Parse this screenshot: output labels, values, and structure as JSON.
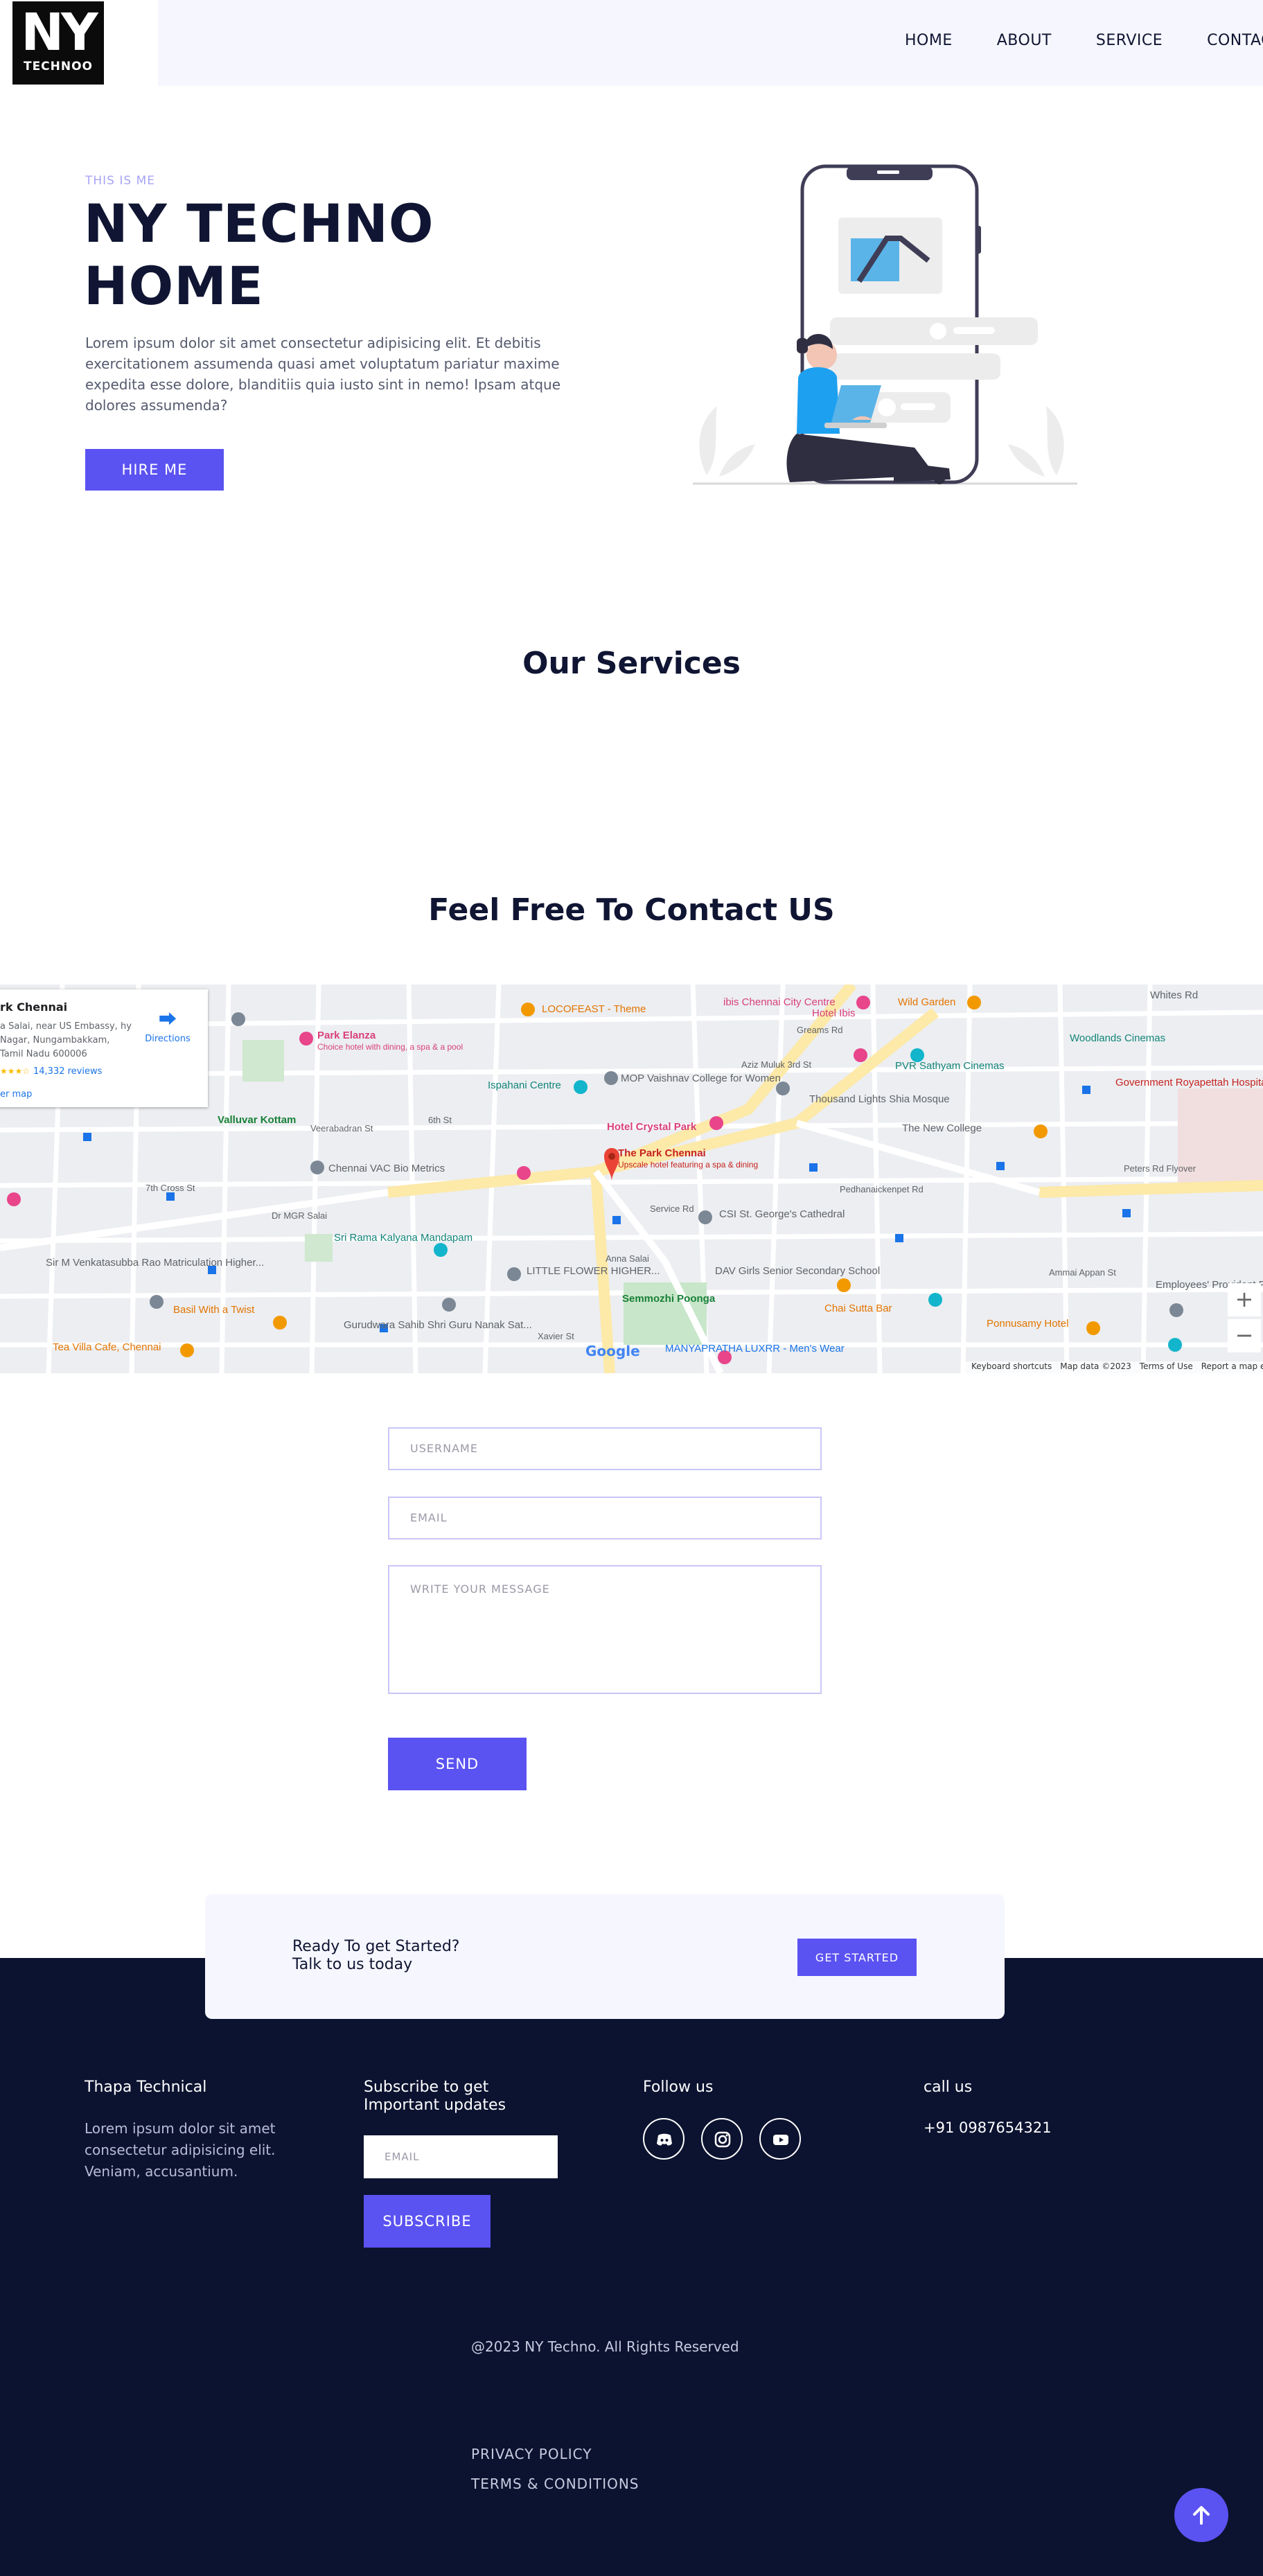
{
  "header": {
    "logo_big": "NY",
    "logo_small": "TECHNOO",
    "nav": [
      "HOME",
      "ABOUT",
      "SERVICE",
      "CONTACT"
    ]
  },
  "hero": {
    "eyebrow": "THIS IS ME",
    "title": "NY TECHNO HOME",
    "description": "Lorem ipsum dolor sit amet consectetur adipisicing elit. Et debitis exercitationem assumenda quasi amet voluptatum pariatur maxime expedita esse dolore, blanditiis quia iusto sint in nemo! Ipsam atque dolores assumenda?",
    "button": "HIRE ME"
  },
  "services": {
    "title": "Our Services"
  },
  "contact": {
    "title": "Feel Free To Contact US"
  },
  "map": {
    "card": {
      "name": "rk Chennai",
      "address": "a Salai, near US Embassy, hy Nagar, Nungambakkam, Tamil Nadu 600006",
      "rating_stars": "★★★☆",
      "reviews": "14,332 reviews",
      "larger_map": "er map",
      "directions": "Directions"
    },
    "labels": [
      "LOCOFEAST - Theme",
      "ibis Chennai City Centre",
      "Hotel Ibis",
      "Wild Garden",
      "Whites Rd",
      "Park Elanza",
      "Choice hotel with dining, a spa & a pool",
      "Woodlands Cinemas",
      "Ispahani Centre",
      "MOP Vaishnav College for Women",
      "PVR Sathyam Cinemas",
      "Government Royapettah Hospital",
      "Valluvar Kottam",
      "Veerabadran St",
      "Hotel Crystal Park",
      "Thousand Lights Shia Mosque",
      "The New College",
      "Chennai VAC Bio Metrics",
      "The Park Chennai",
      "Upscale hotel featuring a spa & dining",
      "Peters Rd Flyover",
      "Dr MGR Salai",
      "Sri Rama Kalyana Mandapam",
      "CSI St. George's Cathedral",
      "Sir M Venkatasubba Rao Matriculation Higher...",
      "LITTLE FLOWER HIGHER...",
      "Semmozhi Poonga",
      "DAV Girls Senior Secondary School",
      "Chai Sutta Bar",
      "Basil With a Twist",
      "Gurudwara Sahib Shri Guru Nanak Sat...",
      "Ammai Appan St",
      "Employees' Provident Fund Regional",
      "Tea Villa Cafe, Chennai",
      "Ponnusamy Hotel",
      "MANYAPRATHA LUXRR - Men's Wear",
      "Anna Salai",
      "Service Rd",
      "Xavier St",
      "Aziz Muluk 3rd St",
      "Greams Rd",
      "Pedhanaickenpet Rd",
      "6th St",
      "7th Cross St"
    ],
    "google": "Google",
    "footer": [
      "Keyboard shortcuts",
      "Map data ©2023",
      "Terms of Use",
      "Report a map error"
    ],
    "zoom_in": "+",
    "zoom_out": "−"
  },
  "form": {
    "username_placeholder": "USERNAME",
    "email_placeholder": "EMAIL",
    "message_placeholder": "WRITE YOUR MESSAGE",
    "send": "SEND"
  },
  "cta": {
    "text": "Ready To get Started?\nTalk to us today",
    "button": "GET STARTED"
  },
  "footer": {
    "col1_title": "Thapa Technical",
    "col1_text": "Lorem ipsum dolor sit amet consectetur adipisicing elit. Veniam, accusantium.",
    "col2_title": "Subscribe to get Important updates",
    "email_placeholder": "EMAIL",
    "subscribe": "SUBSCRIBE",
    "col3_title": "Follow us",
    "col4_title": "call us",
    "phone": "+91 0987654321",
    "copyright": "@2023 NY Techno. All Rights Reserved",
    "privacy": "PRIVACY POLICY",
    "terms": "TERMS & CONDITIONS"
  },
  "colors": {
    "accent": "#5b52f2",
    "dark": "#0c1330",
    "header_bg": "#f6f6fe"
  }
}
